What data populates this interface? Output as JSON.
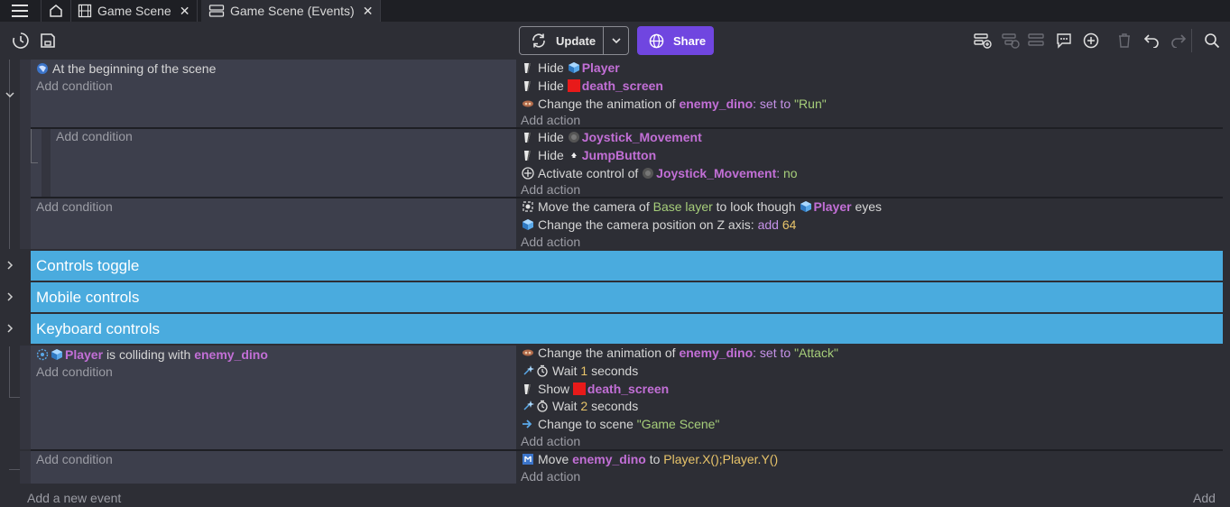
{
  "tabs": [
    {
      "label": "Game Scene",
      "icon": "film-icon",
      "active": false
    },
    {
      "label": "Game Scene (Events)",
      "icon": "events-icon",
      "active": true
    }
  ],
  "toolbar": {
    "update_label": "Update",
    "share_label": "Share",
    "colors": {
      "share": "#7046e0",
      "group": "#4aabde",
      "object": "#c26fd6",
      "number": "#e8c46a",
      "string": "#a6ce7a"
    }
  },
  "events": [
    {
      "conditions": [
        {
          "icon": "scene-icon",
          "text": "At the beginning of the scene"
        }
      ],
      "add_condition": "Add condition",
      "actions": [
        {
          "icon": "hide-icon",
          "pre": "Hide",
          "obj_icon": "cube-icon",
          "obj": "Player"
        },
        {
          "icon": "hide-icon",
          "pre": "Hide",
          "obj_icon": "red-square-icon",
          "obj": "death_screen"
        },
        {
          "icon": "animation-icon",
          "pre": "Change the animation of",
          "obj": "enemy_dino",
          "mid": ": set to",
          "str": "\"Run\""
        }
      ],
      "add_action": "Add action"
    },
    {
      "add_condition": "Add condition",
      "actions": [
        {
          "icon": "hide-icon",
          "pre": "Hide",
          "obj_icon": "joystick-icon",
          "obj": "Joystick_Movement"
        },
        {
          "icon": "hide-icon",
          "pre": "Hide",
          "obj_icon": "jump-icon",
          "obj": "JumpButton"
        },
        {
          "icon": "control-icon",
          "pre": "Activate control of",
          "obj_icon": "joystick-icon",
          "obj": "Joystick_Movement",
          "mid": ":",
          "str": "no"
        }
      ],
      "add_action": "Add action"
    },
    {
      "add_condition": "Add condition",
      "actions": [
        {
          "icon": "camera-icon",
          "pre": "Move the camera of",
          "str": "Base layer",
          "mid": "to look though",
          "obj_icon": "cube-icon",
          "obj": "Player",
          "post": "eyes"
        },
        {
          "icon": "cube-icon",
          "pre": "Change the camera position on Z axis:",
          "kw": "add",
          "num": "64"
        }
      ],
      "add_action": "Add action"
    }
  ],
  "groups": [
    "Controls toggle",
    "Mobile controls",
    "Keyboard controls"
  ],
  "event4": {
    "condition": {
      "obj": "Player",
      "mid": "is colliding with",
      "obj2": "enemy_dino"
    },
    "add_condition": "Add condition",
    "actions": [
      {
        "pre": "Change the animation of",
        "obj": "enemy_dino",
        "mid": ": set to",
        "str": "\"Attack\""
      },
      {
        "pre": "Wait",
        "num": "1",
        "post": "seconds"
      },
      {
        "pre": "Show",
        "obj": "death_screen"
      },
      {
        "pre": "Wait",
        "num": "2",
        "post": "seconds"
      },
      {
        "pre": "Change to scene",
        "str": "\"Game Scene\""
      }
    ],
    "add_action": "Add action"
  },
  "event5": {
    "add_condition": "Add condition",
    "action": {
      "pre": "Move",
      "obj": "enemy_dino",
      "mid": "to",
      "num": "Player.X();Player.Y()"
    },
    "add_action": "Add action"
  },
  "footer": {
    "add_event": "Add a new event",
    "add": "Add"
  }
}
